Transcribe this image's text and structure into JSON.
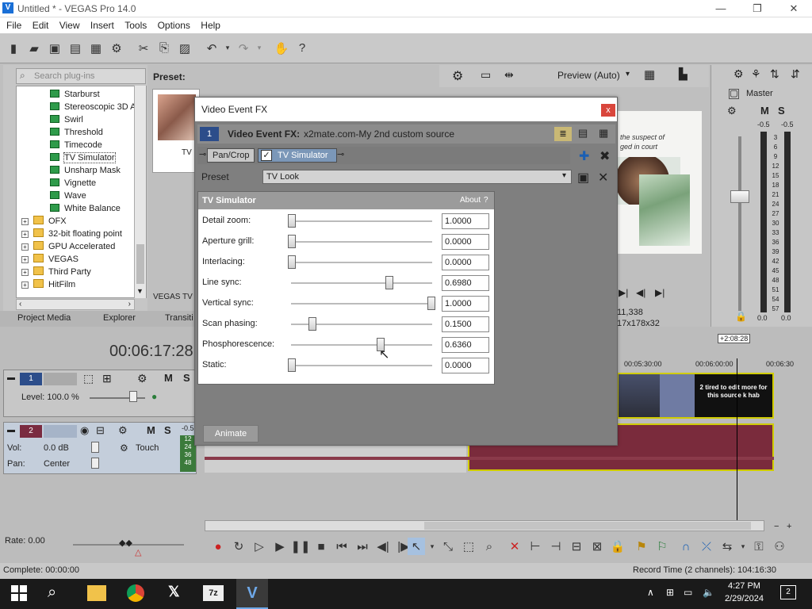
{
  "window": {
    "title": "Untitled * - VEGAS Pro 14.0",
    "min": "—",
    "max": "❐",
    "close": "✕"
  },
  "menu": [
    "File",
    "Edit",
    "View",
    "Insert",
    "Tools",
    "Options",
    "Help"
  ],
  "plugins": {
    "search_placeholder": "Search plug-ins",
    "items": [
      {
        "label": "Starburst",
        "type": "fx"
      },
      {
        "label": "Stereoscopic 3D A",
        "type": "fx"
      },
      {
        "label": "Swirl",
        "type": "fx"
      },
      {
        "label": "Threshold",
        "type": "fx"
      },
      {
        "label": "Timecode",
        "type": "fx"
      },
      {
        "label": "TV Simulator",
        "type": "fx",
        "selected": true
      },
      {
        "label": "Unsharp Mask",
        "type": "fx"
      },
      {
        "label": "Vignette",
        "type": "fx"
      },
      {
        "label": "Wave",
        "type": "fx"
      },
      {
        "label": "White Balance",
        "type": "fx"
      },
      {
        "label": "OFX",
        "type": "folder"
      },
      {
        "label": "32-bit floating point",
        "type": "folder"
      },
      {
        "label": "GPU Accelerated",
        "type": "folder"
      },
      {
        "label": "VEGAS",
        "type": "folder"
      },
      {
        "label": "Third Party",
        "type": "folder"
      },
      {
        "label": "HitFilm",
        "type": "folder"
      }
    ],
    "preset_label": "Preset:",
    "preview_caption": "TV",
    "bottom_caption": "VEGAS TV S"
  },
  "tabs": [
    "Project Media",
    "Explorer",
    "Transiti"
  ],
  "preview": {
    "mode": "Preview (Auto)",
    "frame": "11,338",
    "size": "17x178x32",
    "caption_top": "the suspect of",
    "caption2": "ged in court"
  },
  "master": {
    "label": "Master",
    "db_left": "-0.5",
    "db_right": "-0.5",
    "scale": [
      "3",
      "6",
      "9",
      "12",
      "15",
      "18",
      "21",
      "24",
      "27",
      "30",
      "33",
      "36",
      "39",
      "42",
      "45",
      "48",
      "51",
      "54",
      "57"
    ],
    "bottom_l": "0.0",
    "bottom_r": "0.0"
  },
  "timeline": {
    "time": "00:06:17:28",
    "marker": "+2:08:28",
    "ruler": [
      "00:05:30:00",
      "00:06:00:00",
      "00:06:30"
    ],
    "track1": {
      "num": "1",
      "level": "Level: 100.0 %"
    },
    "track2": {
      "num": "2",
      "vol_label": "Vol:",
      "vol_val": "0.0 dB",
      "pan_label": "Pan:",
      "pan_val": "Center",
      "touch": "Touch",
      "db": "-0.5",
      "meter": [
        "12",
        "24",
        "36",
        "48"
      ]
    },
    "overlay_text": "2 tired to edit more for this source k hab",
    "rate": "Rate: 0.00"
  },
  "status": {
    "left": "Complete: 00:00:00",
    "right": "Record Time (2 channels): 104:16:30"
  },
  "dialog": {
    "title": "Video Event FX",
    "close": "x",
    "fx_label": "Video Event FX:",
    "fx_source": "x2mate.com-My 2nd custom source",
    "chain_num": "1",
    "chain": [
      "Pan/Crop",
      "TV Simulator"
    ],
    "preset_label": "Preset",
    "preset_value": "TV Look",
    "panel_title": "TV Simulator",
    "about": "About",
    "help": "?",
    "params": [
      {
        "label": "Detail zoom:",
        "value": "1.0000",
        "pos": 0.0
      },
      {
        "label": "Aperture grill:",
        "value": "0.0000",
        "pos": 0.0
      },
      {
        "label": "Interlacing:",
        "value": "0.0000",
        "pos": 0.0
      },
      {
        "label": "Line sync:",
        "value": "0.6980",
        "pos": 0.698
      },
      {
        "label": "Vertical sync:",
        "value": "1.0000",
        "pos": 1.0
      },
      {
        "label": "Scan phasing:",
        "value": "0.1500",
        "pos": 0.15
      },
      {
        "label": "Phosphorescence:",
        "value": "0.6360",
        "pos": 0.636
      },
      {
        "label": "Static:",
        "value": "0.0000",
        "pos": 0.0
      }
    ],
    "animate": "Animate"
  },
  "taskbar": {
    "time": "4:27 PM",
    "date": "2/29/2024",
    "notif": "2"
  }
}
